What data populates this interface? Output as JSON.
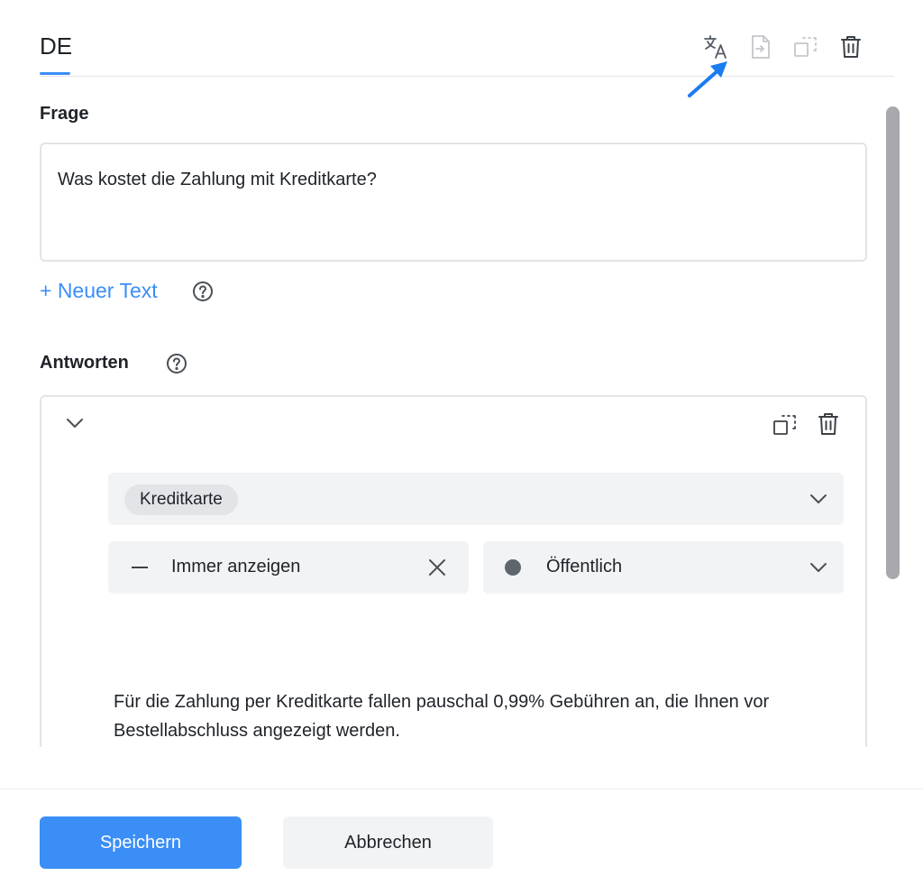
{
  "tabs": {
    "active_label": "DE"
  },
  "toolbar": {
    "icons": [
      "translate-icon",
      "file-import-icon",
      "duplicate-icon",
      "trash-icon"
    ],
    "disabled": [
      "file-import-icon",
      "duplicate-icon"
    ]
  },
  "question": {
    "label": "Frage",
    "text": "Was kostet die Zahlung mit Kreditkarte?",
    "add_text_label": "+ Neuer Text"
  },
  "answers": {
    "label": "Antworten",
    "items": [
      {
        "keyword_chip": "Kreditkarte",
        "visibility": "Immer anzeigen",
        "status": "Öffentlich",
        "text": "Für die Zahlung per Kreditkarte fallen pauschal 0,99% Gebühren an, die Ihnen vor Bestellabschluss angezeigt werden."
      }
    ]
  },
  "footer": {
    "save_label": "Speichern",
    "cancel_label": "Abbrechen"
  },
  "colors": {
    "accent": "#3a8ef6",
    "field_bg": "#f2f3f5",
    "border": "#e2e4e7",
    "text": "#1f2329"
  }
}
